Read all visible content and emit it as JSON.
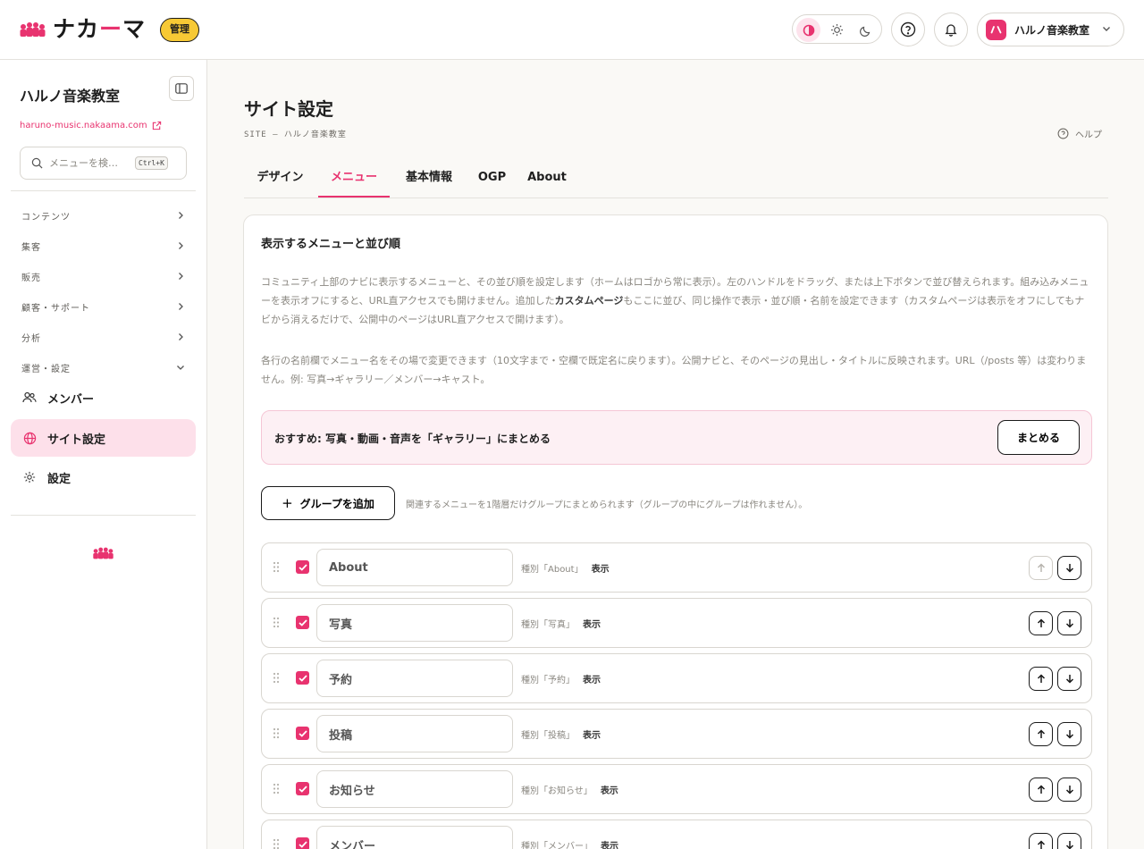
{
  "brand": {
    "name_pre": "ナカ",
    "name_dash": "ー",
    "name_post": "マ",
    "admin_badge": "管理",
    "accent": "#e8336f"
  },
  "header": {
    "account_name": "ハルノ音楽教室",
    "theme_modes": [
      "contrast",
      "light",
      "dark"
    ],
    "active_theme": "contrast"
  },
  "sidebar": {
    "site_name": "ハルノ音楽教室",
    "site_url": "haruno-music.nakaama.com",
    "search_placeholder": "メニューを検…",
    "search_shortcut": "Ctrl+K",
    "groups": [
      {
        "label": "コンテンツ",
        "expanded": false
      },
      {
        "label": "集客",
        "expanded": false
      },
      {
        "label": "販売",
        "expanded": false
      },
      {
        "label": "顧客・サポート",
        "expanded": false
      },
      {
        "label": "分析",
        "expanded": false
      },
      {
        "label": "運営・設定",
        "expanded": true
      }
    ],
    "items": [
      {
        "label": "メンバー",
        "icon": "users-icon",
        "active": false
      },
      {
        "label": "サイト設定",
        "icon": "globe-icon",
        "active": true
      },
      {
        "label": "設定",
        "icon": "gear-icon",
        "active": false
      }
    ]
  },
  "page": {
    "title": "サイト設定",
    "subtitle": "SITE — ハルノ音楽教室",
    "help": "ヘルプ"
  },
  "tabs": [
    {
      "label": "デザイン",
      "active": false
    },
    {
      "label": "メニュー",
      "active": true
    },
    {
      "label": "基本情報",
      "active": false
    },
    {
      "label": "OGP",
      "active": false
    },
    {
      "label": "About",
      "active": false
    }
  ],
  "menu_card": {
    "title": "表示するメニューと並び順",
    "desc1_a": "コミュニティ上部のナビに表示するメニューと、その並び順を設定します（ホームはロゴから常に表示）。左のハンドルをドラッグ、または上下ボタンで並び替えられます。組み込みメニューを表示オフにすると、URL直アクセスでも開けません。追加した",
    "desc1_bold": "カスタムページ",
    "desc1_b": "もここに並び、同じ操作で表示・並び順・名前を設定できます（カスタムページは表示をオフにしてもナビから消えるだけで、公開中のページはURL直アクセスで開けます）。",
    "desc2": "各行の名前欄でメニュー名をその場で変更できます（10文字まで・空欄で既定名に戻ります）。公開ナビと、そのページの見出し・タイトルに反映されます。URL（/posts 等）は変わりません。例: 写真→ギャラリー／メンバー→キャスト。",
    "recommend_text": "おすすめ: 写真・動画・音声を「ギャラリー」にまとめる",
    "recommend_button": "まとめる",
    "add_group_label": "グループを追加",
    "add_group_hint": "関連するメニューを1階層だけグループにまとめられます（グループの中にグループは作れません）。",
    "rows": [
      {
        "name": "About",
        "meta": "種別「About」",
        "status": "表示",
        "checked": true,
        "up_disabled": true
      },
      {
        "name": "写真",
        "meta": "種別「写真」",
        "status": "表示",
        "checked": true,
        "up_disabled": false
      },
      {
        "name": "予約",
        "meta": "種別「予約」",
        "status": "表示",
        "checked": true,
        "up_disabled": false
      },
      {
        "name": "投稿",
        "meta": "種別「投稿」",
        "status": "表示",
        "checked": true,
        "up_disabled": false
      },
      {
        "name": "お知らせ",
        "meta": "種別「お知らせ」",
        "status": "表示",
        "checked": true,
        "up_disabled": false
      },
      {
        "name": "メンバー",
        "meta": "種別「メンバー」",
        "status": "表示",
        "checked": true,
        "up_disabled": false
      }
    ]
  }
}
